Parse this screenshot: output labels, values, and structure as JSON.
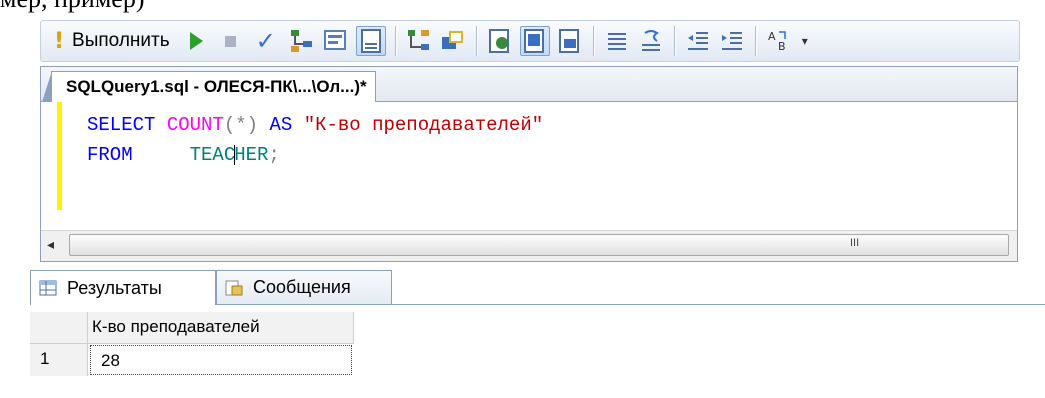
{
  "doc_fragment": "мер, пример)",
  "toolbar": {
    "execute_label": "Выполнить"
  },
  "query_tab": {
    "title": "SQLQuery1.sql - ОЛЕСЯ-ПК\\...\\Ол...)*"
  },
  "code": {
    "line1": {
      "select": "SELECT",
      "count": "COUNT",
      "args": "(*)",
      "as": "AS",
      "alias": "\"К-во преподавателей\""
    },
    "line2": {
      "from": "FROM",
      "table_a": "TEAC",
      "table_b": "HER",
      "semicolon": ";"
    }
  },
  "scrollbar": {
    "grip": "III"
  },
  "results": {
    "tabs": [
      "Результаты",
      "Сообщения"
    ],
    "columns": [
      "К-во преподавателей"
    ],
    "rows": [
      {
        "num": "1",
        "values": [
          "28"
        ]
      }
    ]
  },
  "colors": {
    "keyword": "#0000ff",
    "function": "#ff00ff",
    "string": "#c00000",
    "identifier": "#008080",
    "change_marker": "#fff200"
  }
}
